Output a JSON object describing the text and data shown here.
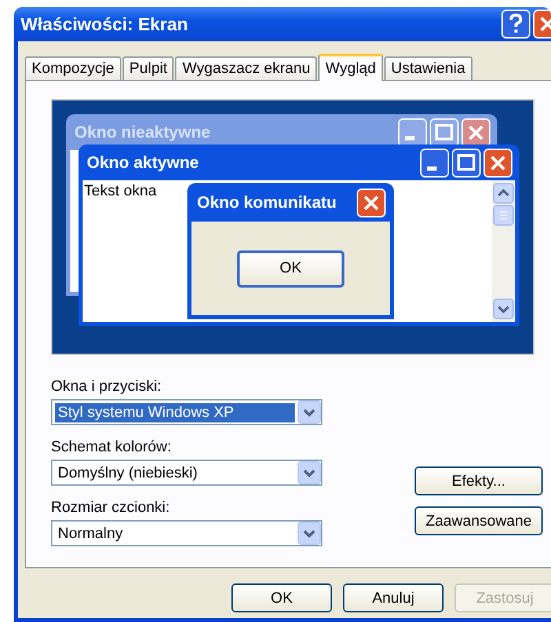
{
  "window": {
    "title": "Właściwości: Ekran"
  },
  "tabs": [
    {
      "label": "Kompozycje",
      "selected": false
    },
    {
      "label": "Pulpit",
      "selected": false
    },
    {
      "label": "Wygaszacz ekranu",
      "selected": false
    },
    {
      "label": "Wygląd",
      "selected": true
    },
    {
      "label": "Ustawienia",
      "selected": false
    }
  ],
  "preview": {
    "inactive_window": {
      "title": "Okno nieaktywne"
    },
    "active_window": {
      "title": "Okno aktywne",
      "text": "Tekst okna"
    },
    "message_box": {
      "title": "Okno komunikatu",
      "button": "OK"
    }
  },
  "fields": [
    {
      "label": "Okna i przyciski:",
      "value": "Styl systemu Windows XP",
      "selected": true
    },
    {
      "label": "Schemat kolorów:",
      "value": "Domyślny (niebieski)",
      "selected": false
    },
    {
      "label": "Rozmiar czcionki:",
      "value": "Normalny",
      "selected": false
    }
  ],
  "side_buttons": [
    "Efekty...",
    "Zaawansowane"
  ],
  "dialog_buttons": [
    {
      "label": "OK",
      "disabled": false
    },
    {
      "label": "Anuluj",
      "disabled": false
    },
    {
      "label": "Zastosuj",
      "disabled": true
    }
  ]
}
